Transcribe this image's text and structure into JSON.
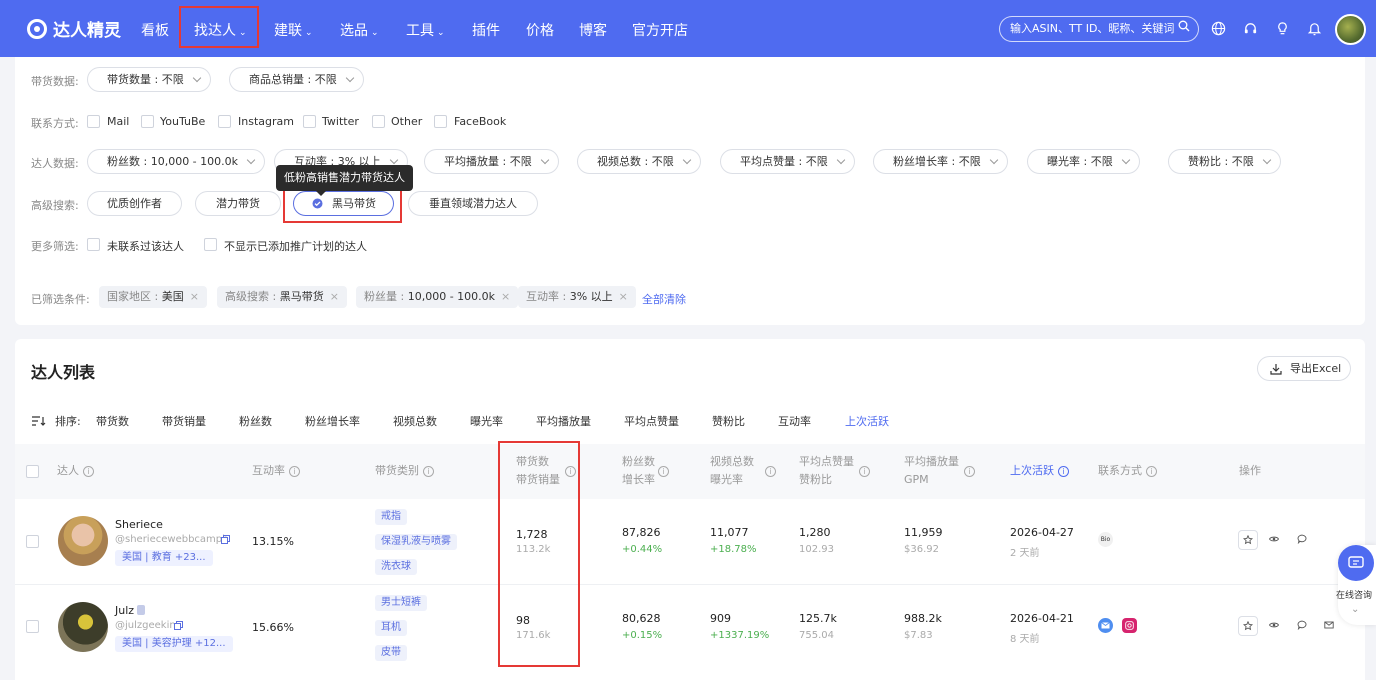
{
  "nav": {
    "logo": "达人精灵",
    "items": [
      {
        "label": "看板",
        "dropdown": false
      },
      {
        "label": "找达人",
        "dropdown": true
      },
      {
        "label": "建联",
        "dropdown": true
      },
      {
        "label": "选品",
        "dropdown": true
      },
      {
        "label": "工具",
        "dropdown": true
      },
      {
        "label": "插件",
        "dropdown": false
      },
      {
        "label": "价格",
        "dropdown": false
      },
      {
        "label": "博客",
        "dropdown": false
      },
      {
        "label": "官方开店",
        "dropdown": false
      }
    ],
    "active": "找达人",
    "search_placeholder": "输入ASIN、TT ID、昵称、关键词",
    "icons": [
      "globe-icon",
      "headset-icon",
      "bulb-icon",
      "bell-icon"
    ],
    "accent": "#4f6bf0"
  },
  "filters": {
    "sales_label": "带货数据:",
    "sales_pills": [
      "带货数量 : 不限",
      "商品总销量 : 不限"
    ],
    "contact_label": "联系方式:",
    "contact_options": [
      "Mail",
      "YouTuBe",
      "Instagram",
      "Twitter",
      "Other",
      "FaceBook"
    ],
    "creator_label": "达人数据:",
    "creator_pills": [
      "粉丝数 : 10,000 - 100.0k",
      "互动率 : 3% 以上",
      "平均播放量 : 不限",
      "视频总数 : 不限",
      "平均点赞量 : 不限",
      "粉丝增长率 : 不限",
      "曝光率 : 不限",
      "赞粉比 : 不限"
    ],
    "advanced_label": "高级搜索:",
    "advanced_pills": [
      "优质创作者",
      "潜力带货",
      "黑马带货",
      "垂直领域潜力达人"
    ],
    "advanced_selected": "黑马带货",
    "tooltip": "低粉高销售潜力带货达人",
    "more_label": "更多筛选:",
    "more_options": [
      "未联系过该达人",
      "不显示已添加推广计划的达人"
    ],
    "applied_label": "已筛选条件:",
    "applied": [
      {
        "key": "国家地区 : ",
        "value": "美国"
      },
      {
        "key": "高级搜索 : ",
        "value": "黑马带货"
      },
      {
        "key": "粉丝量 : ",
        "value": "10,000 - 100.0k"
      },
      {
        "key": "互动率 : ",
        "value": "3% 以上"
      }
    ],
    "clear_all": "全部清除"
  },
  "list": {
    "title": "达人列表",
    "export_label": "导出Excel",
    "sort_label": "排序:",
    "sort_options": [
      "带货数",
      "带货销量",
      "粉丝数",
      "粉丝增长率",
      "视频总数",
      "曝光率",
      "平均播放量",
      "平均点赞量",
      "赞粉比",
      "互动率",
      "上次活跃"
    ],
    "sort_active": "上次活跃",
    "columns": {
      "creator": "达人",
      "engagement": "互动率",
      "category": "带货类别",
      "sales_count": "带货数",
      "sales_volume": "带货销量",
      "followers": "粉丝数",
      "growth": "增长率",
      "videos": "视频总数",
      "exposure": "曝光率",
      "avg_likes": "平均点赞量",
      "like_ratio": "赞粉比",
      "avg_views": "平均播放量",
      "gpm": "GPM",
      "last_active": "上次活跃",
      "contact": "联系方式",
      "actions": "操作"
    },
    "rows": [
      {
        "name": "Sheriece",
        "handle": "@sheriecewebbcampb",
        "tags": "美国 | 教育 +23...",
        "engagement": "13.15%",
        "categories": [
          "戒指",
          "保湿乳液与喷雾",
          "洗衣球"
        ],
        "sales_count": "1,728",
        "sales_volume": "113.2k",
        "followers": "87,826",
        "growth": "+0.44%",
        "videos": "11,077",
        "exposure": "+18.78%",
        "avg_likes": "1,280",
        "like_ratio": "102.93",
        "avg_views": "11,959",
        "gpm": "$36.92",
        "last_active": "2026-04-27",
        "last_active_ago": "2 天前",
        "contact_bio": "Bio"
      },
      {
        "name": "Julz",
        "handle": "@julzgeekin",
        "tags": "美国 | 美容护理 +12...",
        "engagement": "15.66%",
        "categories": [
          "男士短裤",
          "耳机",
          "皮带"
        ],
        "sales_count": "98",
        "sales_volume": "171.6k",
        "followers": "80,628",
        "growth": "+0.15%",
        "videos": "909",
        "exposure": "+1337.19%",
        "avg_likes": "125.7k",
        "like_ratio": "755.04",
        "avg_views": "988.2k",
        "gpm": "$7.83",
        "last_active": "2026-04-21",
        "last_active_ago": "8 天前"
      }
    ]
  },
  "chat": {
    "label": "在线咨询"
  }
}
